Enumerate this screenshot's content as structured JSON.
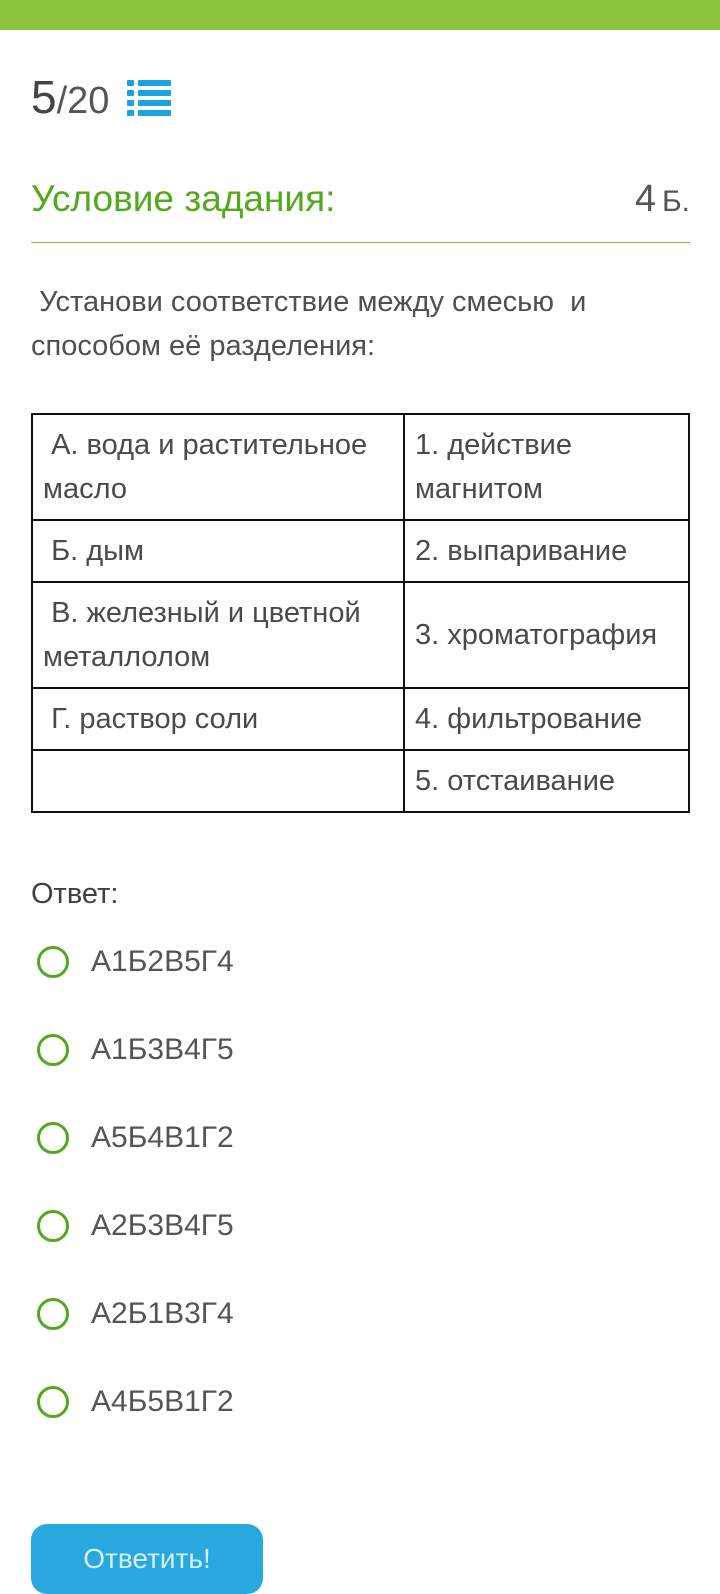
{
  "header": {
    "current": "5",
    "separator": "/",
    "total": "20",
    "list_icon": "list-icon"
  },
  "condition": {
    "title": "Условие задания:",
    "points_value": "4",
    "points_unit": "Б."
  },
  "question": " Установи соответствие между смесью  и способом её разделения:",
  "table": {
    "rows": [
      {
        "left": " А. вода и растительное масло",
        "right": "1. действие магнитом"
      },
      {
        "left": " Б. дым",
        "right": "2. выпаривание"
      },
      {
        "left": " В. железный и цветной металлолом",
        "right": "3. хроматография"
      },
      {
        "left": " Г. раствор соли",
        "right": "4. фильтрование"
      },
      {
        "left": "",
        "right": "5. отстаивание"
      }
    ]
  },
  "answer": {
    "label": "Ответ:",
    "options": [
      "А1Б2В5Г4",
      "А1Б3В4Г5",
      "А5Б4В1Г2",
      "А2Б3В4Г5",
      "А2Б1В3Г4",
      "А4Б5В1Г2"
    ]
  },
  "submit_label": "Ответить!",
  "colors": {
    "accent_green": "#8cc63f",
    "title_green": "#53a81c",
    "button_blue": "#29a8e0",
    "icon_blue": "#1aa3df"
  }
}
